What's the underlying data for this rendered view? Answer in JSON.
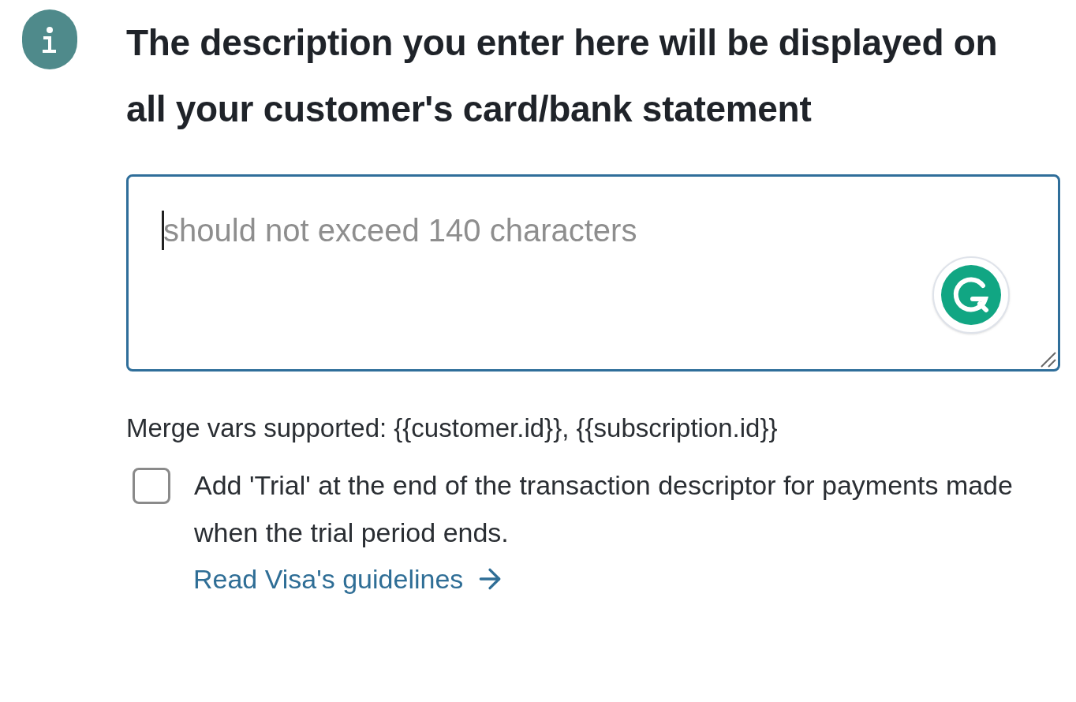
{
  "heading": "The description you enter here will be displayed on all your customer's card/bank statement",
  "description_field": {
    "placeholder": "should not exceed 140 characters"
  },
  "merge_vars_note": "Merge vars supported: {{customer.id}}, {{subscription.id}}",
  "trial_option": {
    "label": "Add 'Trial' at the end of the transaction descriptor for payments made when the trial period ends.",
    "checked": false
  },
  "guidelines_link": "Read Visa's guidelines"
}
